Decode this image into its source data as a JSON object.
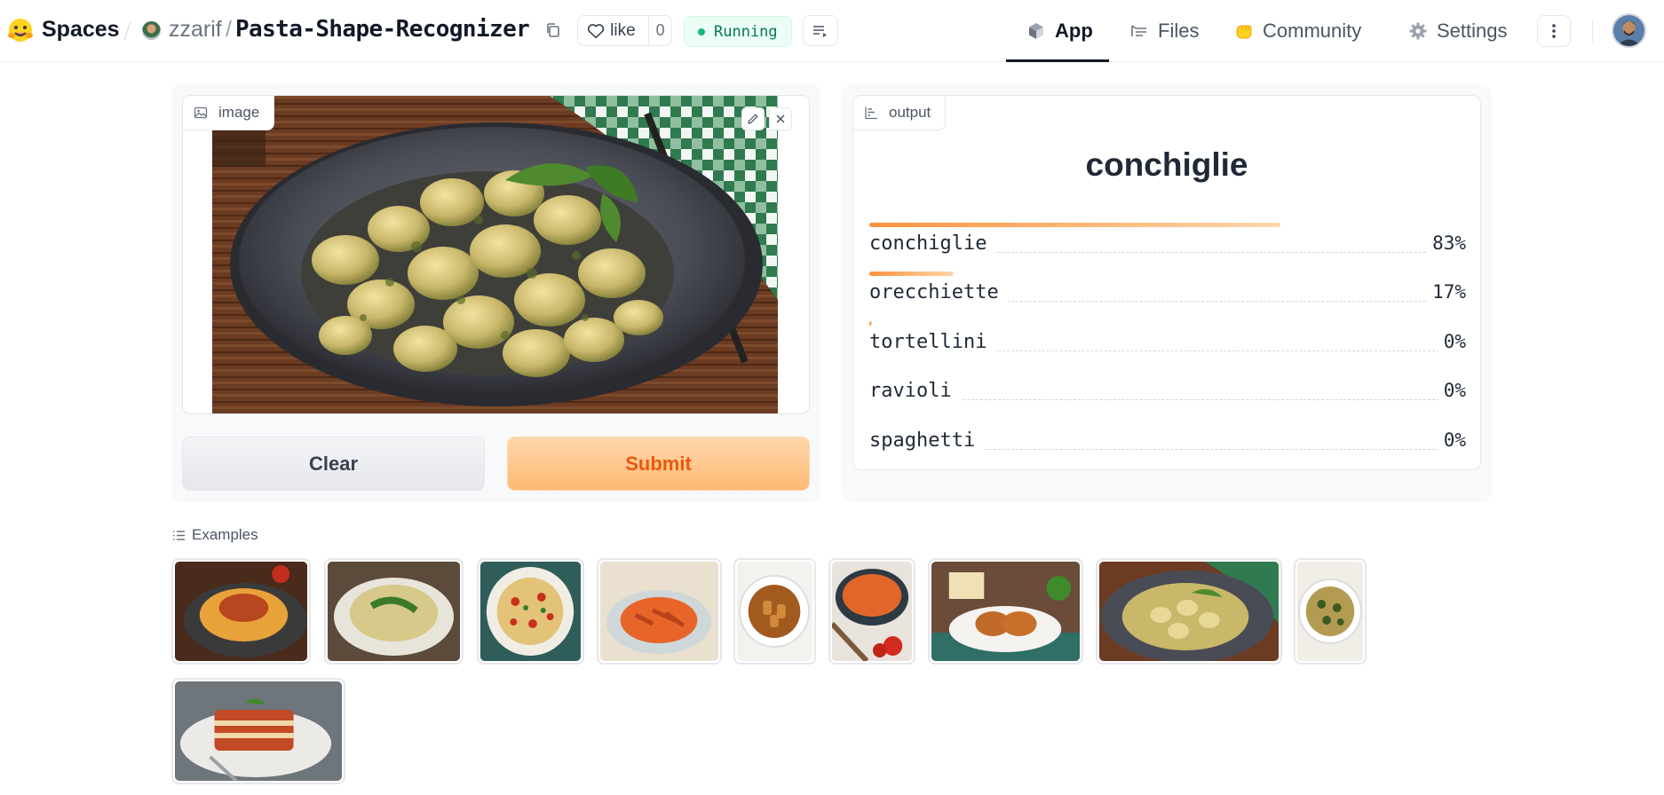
{
  "header": {
    "brand": "Spaces",
    "owner": "zzarif",
    "separator": "/",
    "repo_name": "Pasta-Shape-Recognizer",
    "like_label": "like",
    "like_count": "0",
    "status": "Running",
    "tabs": [
      {
        "label": "App",
        "icon": "cube-icon",
        "active": true
      },
      {
        "label": "Files",
        "icon": "files-icon",
        "active": false
      },
      {
        "label": "Community",
        "icon": "hand-icon",
        "active": false
      },
      {
        "label": "Settings",
        "icon": "gear-icon",
        "active": false
      }
    ]
  },
  "input": {
    "label": "image",
    "clear_label": "Clear",
    "submit_label": "Submit"
  },
  "output": {
    "label": "output",
    "top_label": "conchiglie",
    "confidences": [
      {
        "label": "conchiglie",
        "percent": "83%",
        "value": 0.83
      },
      {
        "label": "orecchiette",
        "percent": "17%",
        "value": 0.17
      },
      {
        "label": "tortellini",
        "percent": "0%",
        "value": 0.004
      },
      {
        "label": "ravioli",
        "percent": "0%",
        "value": 0.0
      },
      {
        "label": "spaghetti",
        "percent": "0%",
        "value": 0.0
      }
    ]
  },
  "examples": {
    "label": "Examples",
    "items": [
      "spaghetti-bolognese",
      "spaghetti-spinach",
      "fusilli-salad",
      "penne-tomato",
      "rigatoni",
      "macaroni-pot",
      "cannelloni",
      "conchiglie-pesto",
      "orecchiette-greens",
      "lasagna"
    ]
  },
  "colors": {
    "accent_orange": "#ea580c",
    "bar_start": "#fb923c",
    "bar_end": "#fed7aa",
    "status_green": "#10b981"
  }
}
